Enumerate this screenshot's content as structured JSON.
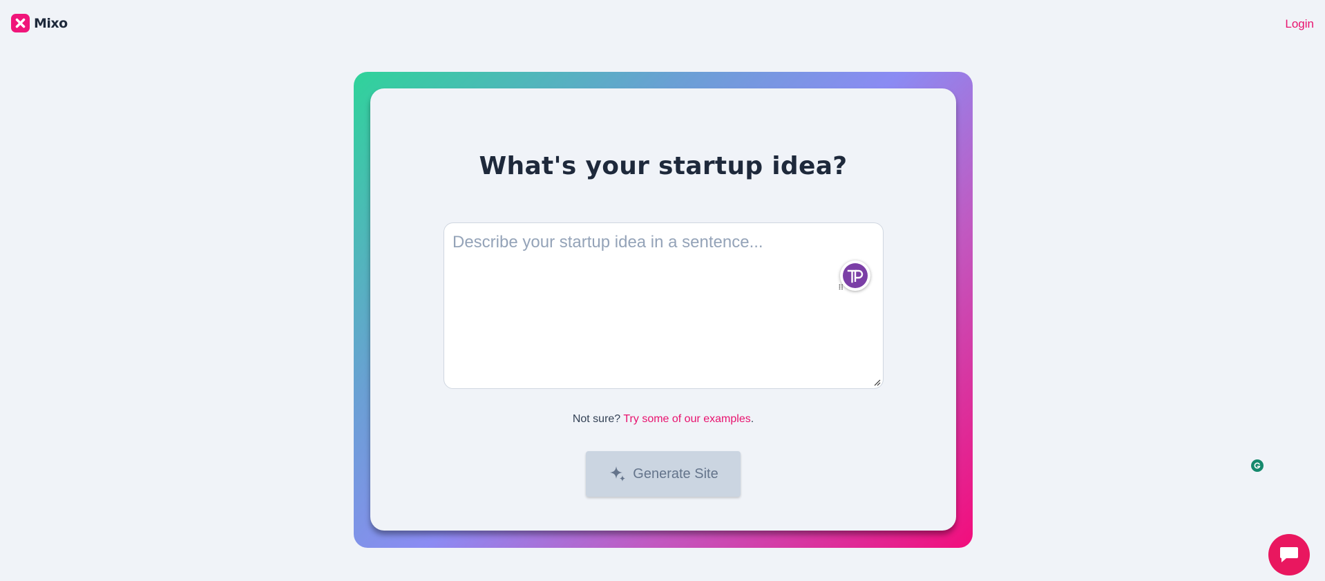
{
  "header": {
    "brand": "Mixo",
    "login_label": "Login"
  },
  "main": {
    "headline": "What's your startup idea?",
    "idea_placeholder": "Describe your startup idea in a sentence...",
    "idea_value": "",
    "helper_prefix": "Not sure?",
    "helper_link": "Try some of our examples",
    "helper_suffix": ".",
    "generate_label": "Generate Site"
  },
  "icons": {
    "logo": "close-x-icon",
    "extension": "tp-extension-icon",
    "grammarly": "grammarly-icon",
    "chat": "chat-bubble-icon",
    "sparkle": "sparkle-icon"
  },
  "colors": {
    "accent": "#e8126e",
    "gradient_start": "#2fd39a",
    "gradient_mid": "#8b8bf3",
    "gradient_end": "#f20d7c",
    "button_disabled_bg": "#cbd5e1",
    "page_bg": "#f0f3f8"
  }
}
